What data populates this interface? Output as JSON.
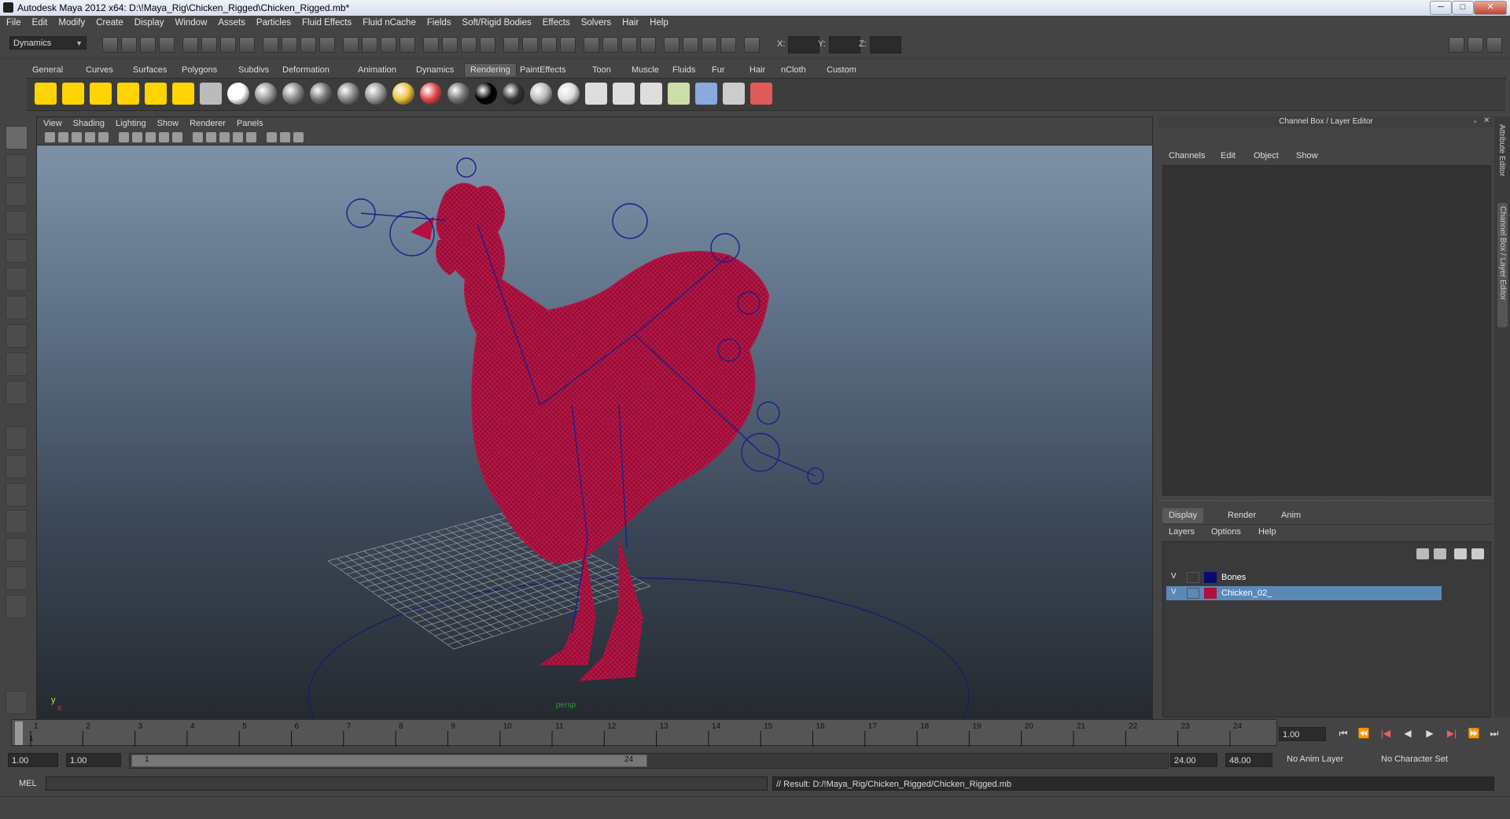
{
  "window": {
    "title": "Autodesk Maya 2012 x64: D:\\!Maya_Rig\\Chicken_Rigged\\Chicken_Rigged.mb*",
    "min": "─",
    "max": "□",
    "close": "✕"
  },
  "menubar": [
    "File",
    "Edit",
    "Modify",
    "Create",
    "Display",
    "Window",
    "Assets",
    "Particles",
    "Fluid Effects",
    "Fluid nCache",
    "Fields",
    "Soft/Rigid Bodies",
    "Effects",
    "Solvers",
    "Hair",
    "Help"
  ],
  "status": {
    "menuset": "Dynamics",
    "x_label": "X:",
    "y_label": "Y:",
    "z_label": "Z:"
  },
  "shelf_tabs": [
    "General",
    "Curves",
    "Surfaces",
    "Polygons",
    "Subdivs",
    "Deformation",
    "Animation",
    "Dynamics",
    "Rendering",
    "PaintEffects",
    "Toon",
    "Muscle",
    "Fluids",
    "Fur",
    "Hair",
    "nCloth",
    "Custom"
  ],
  "shelf_active": "Rendering",
  "viewport": {
    "menu": [
      "View",
      "Shading",
      "Lighting",
      "Show",
      "Renderer",
      "Panels"
    ],
    "axis_x": "x",
    "axis_y": "y",
    "camera_label": "persp"
  },
  "channel_box": {
    "title": "Channel Box / Layer Editor",
    "menu": [
      "Channels",
      "Edit",
      "Object",
      "Show"
    ],
    "layer_tabs": [
      "Display",
      "Render",
      "Anim"
    ],
    "active_tab": "Display",
    "layer_menu": [
      "Layers",
      "Options",
      "Help"
    ],
    "layers": [
      {
        "v": "V",
        "name": "Bones",
        "color": "#0a0a6e",
        "selected": false
      },
      {
        "v": "V",
        "name": "Chicken_02_",
        "color": "#b0103c",
        "selected": true
      }
    ]
  },
  "side_tabs": {
    "attribute_editor": "Attribute Editor",
    "channel_box": "Channel Box / Layer Editor"
  },
  "timeline": {
    "ticks": [
      "1",
      "2",
      "3",
      "4",
      "5",
      "6",
      "7",
      "8",
      "9",
      "10",
      "11",
      "12",
      "13",
      "14",
      "15",
      "16",
      "17",
      "18",
      "19",
      "20",
      "21",
      "22",
      "23",
      "24"
    ],
    "current_frame_marker": "1",
    "current_time": "1.00"
  },
  "range": {
    "start": "1.00",
    "playback_start": "1.00",
    "slider_start": "1",
    "slider_end": "24",
    "playback_end": "24.00",
    "end": "48.00",
    "anim_layer": "No Anim Layer",
    "char_set": "No Character Set"
  },
  "cmdline": {
    "label": "MEL",
    "result": "// Result: D:/!Maya_Rig/Chicken_Rigged/Chicken_Rigged.mb"
  },
  "colors": {
    "mesh": "#b5103f",
    "rig": "#1c1f8a",
    "selected_row": "#5a89b8"
  }
}
